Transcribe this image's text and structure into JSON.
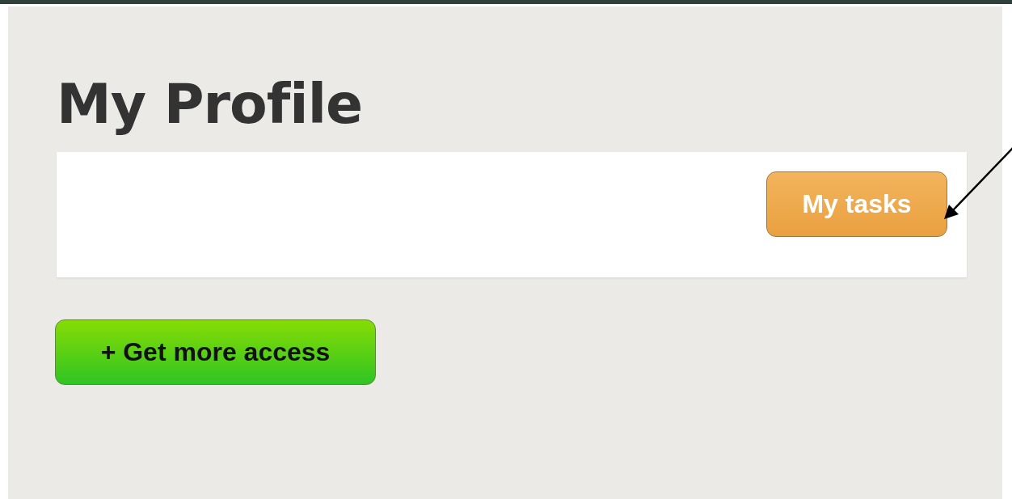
{
  "page": {
    "title": "My Profile"
  },
  "profile_card": {
    "buttons": [
      {
        "label": "My tasks",
        "kind": "secondary"
      }
    ]
  },
  "actions": [
    {
      "label": "+ Get more access",
      "kind": "primary"
    }
  ],
  "annotation": {
    "kind": "arrow"
  }
}
